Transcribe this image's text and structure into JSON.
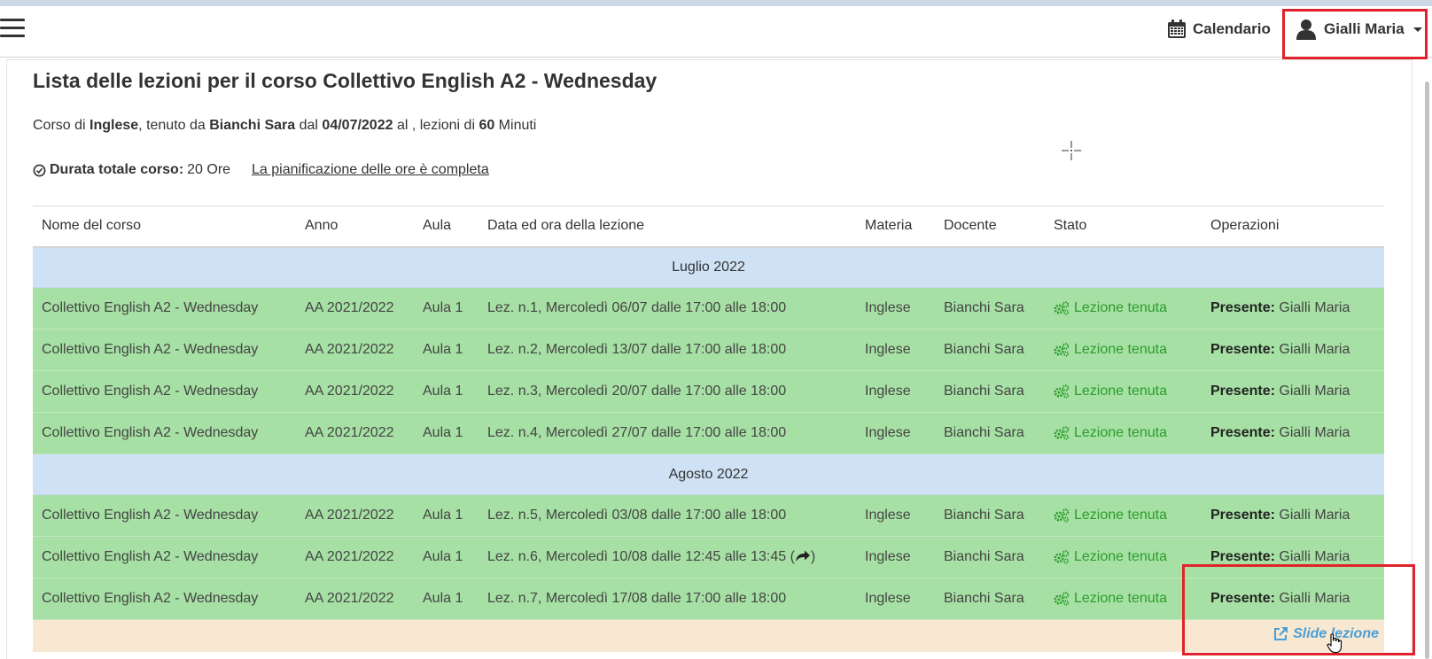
{
  "navbar": {
    "calendar_label": "Calendario",
    "user_label": "Gialli Maria"
  },
  "header": {
    "title_prefix": "Lista delle lezioni per il corso ",
    "course_name": "Collettivo English A2 - Wednesday"
  },
  "course_info": {
    "t1": "Corso di ",
    "subject": "Inglese",
    "t2": ", tenuto da ",
    "teacher": "Bianchi Sara",
    "t3": " dal ",
    "start_date": "04/07/2022",
    "t4": " al , lezioni di ",
    "duration_minutes": "60",
    "t5": " Minuti"
  },
  "duration": {
    "label": "Durata totale corso:",
    "value": "20 Ore",
    "plan_link": "La pianificazione delle ore è completa"
  },
  "table": {
    "columns": [
      "Nome del corso",
      "Anno",
      "Aula",
      "Data ed ora della lezione",
      "Materia",
      "Docente",
      "Stato",
      "Operazioni"
    ],
    "months": [
      "Luglio 2022",
      "Agosto 2022"
    ],
    "rows": [
      {
        "course": "Collettivo English A2 - Wednesday",
        "year": "AA 2021/2022",
        "room": "Aula 1",
        "datetime": "Lez. n.1, Mercoledì 06/07 dalle 17:00 alle 18:00",
        "subject": "Inglese",
        "teacher": "Bianchi Sara",
        "status": "Lezione tenuta",
        "op_label": "Presente:",
        "op_value": " Gialli Maria"
      },
      {
        "course": "Collettivo English A2 - Wednesday",
        "year": "AA 2021/2022",
        "room": "Aula 1",
        "datetime": "Lez. n.2, Mercoledì 13/07 dalle 17:00 alle 18:00",
        "subject": "Inglese",
        "teacher": "Bianchi Sara",
        "status": "Lezione tenuta",
        "op_label": "Presente:",
        "op_value": " Gialli Maria"
      },
      {
        "course": "Collettivo English A2 - Wednesday",
        "year": "AA 2021/2022",
        "room": "Aula 1",
        "datetime": "Lez. n.3, Mercoledì 20/07 dalle 17:00 alle 18:00",
        "subject": "Inglese",
        "teacher": "Bianchi Sara",
        "status": "Lezione tenuta",
        "op_label": "Presente:",
        "op_value": " Gialli Maria"
      },
      {
        "course": "Collettivo English A2 - Wednesday",
        "year": "AA 2021/2022",
        "room": "Aula 1",
        "datetime": "Lez. n.4, Mercoledì 27/07 dalle 17:00 alle 18:00",
        "subject": "Inglese",
        "teacher": "Bianchi Sara",
        "status": "Lezione tenuta",
        "op_label": "Presente:",
        "op_value": " Gialli Maria"
      },
      {
        "course": "Collettivo English A2 - Wednesday",
        "year": "AA 2021/2022",
        "room": "Aula 1",
        "datetime": "Lez. n.5, Mercoledì 03/08 dalle 17:00 alle 18:00",
        "subject": "Inglese",
        "teacher": "Bianchi Sara",
        "status": "Lezione tenuta",
        "op_label": "Presente:",
        "op_value": " Gialli Maria"
      },
      {
        "course": "Collettivo English A2 - Wednesday",
        "year": "AA 2021/2022",
        "room": "Aula 1",
        "datetime": "Lez. n.6, Mercoledì 10/08 dalle 12:45 alle 13:45",
        "datetime_icon": "share-icon",
        "subject": "Inglese",
        "teacher": "Bianchi Sara",
        "status": "Lezione tenuta",
        "op_label": "Presente:",
        "op_value": " Gialli Maria"
      },
      {
        "course": "Collettivo English A2 - Wednesday",
        "year": "AA 2021/2022",
        "room": "Aula 1",
        "datetime": "Lez. n.7, Mercoledì 17/08 dalle 17:00 alle 18:00",
        "subject": "Inglese",
        "teacher": "Bianchi Sara",
        "status": "Lezione tenuta",
        "op_label": "Presente:",
        "op_value": " Gialli Maria"
      }
    ],
    "slides_link": "Slide lezione"
  },
  "colors": {
    "row_green": "#a6e0a4",
    "month_blue": "#cfe2f5",
    "slides_peach": "#f8e8d2",
    "status_green": "#2d9c2d",
    "link_blue": "#4a9fd8",
    "highlight_red": "#e0232a"
  },
  "icons": {
    "menu": "hamburger-icon",
    "calendar": "calendar-icon",
    "user": "user-icon",
    "duration": "check-circle-icon",
    "status": "cogs-icon",
    "slides": "external-link-icon"
  }
}
